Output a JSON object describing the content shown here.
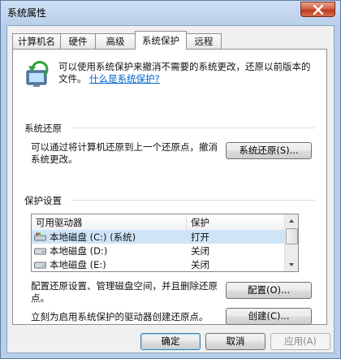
{
  "window": {
    "title": "系统属性"
  },
  "tabs": [
    {
      "label": "计算机名",
      "active": false
    },
    {
      "label": "硬件",
      "active": false
    },
    {
      "label": "高级",
      "active": false
    },
    {
      "label": "系统保护",
      "active": true
    },
    {
      "label": "远程",
      "active": false
    }
  ],
  "intro": {
    "text": "可以使用系统保护来撤消不需要的系统更改，还原以前版本的文件。",
    "link": "什么是系统保护?"
  },
  "restore": {
    "group_title": "系统还原",
    "description": "可以通过将计算机还原到上一个还原点，撤消系统更改。",
    "button_label": "系统还原(S)..."
  },
  "protection": {
    "group_title": "保护设置",
    "columns": [
      "可用驱动器",
      "保护"
    ],
    "drives": [
      {
        "name": "本地磁盘 (C:) (系统)",
        "status": "打开",
        "selected": true,
        "icon": "system-drive-icon"
      },
      {
        "name": "本地磁盘 (D:)",
        "status": "关闭",
        "selected": false,
        "icon": "drive-icon"
      },
      {
        "name": "本地磁盘 (E:)",
        "status": "关闭",
        "selected": false,
        "icon": "drive-icon"
      }
    ],
    "configure_text": "配置还原设置、管理磁盘空间，并且删除还原点。",
    "configure_button": "配置(O)...",
    "create_text": "立刻为启用系统保护的驱动器创建还原点。",
    "create_button": "创建(C)..."
  },
  "footer": {
    "ok": "确定",
    "cancel": "取消",
    "apply": "应用(A)"
  }
}
